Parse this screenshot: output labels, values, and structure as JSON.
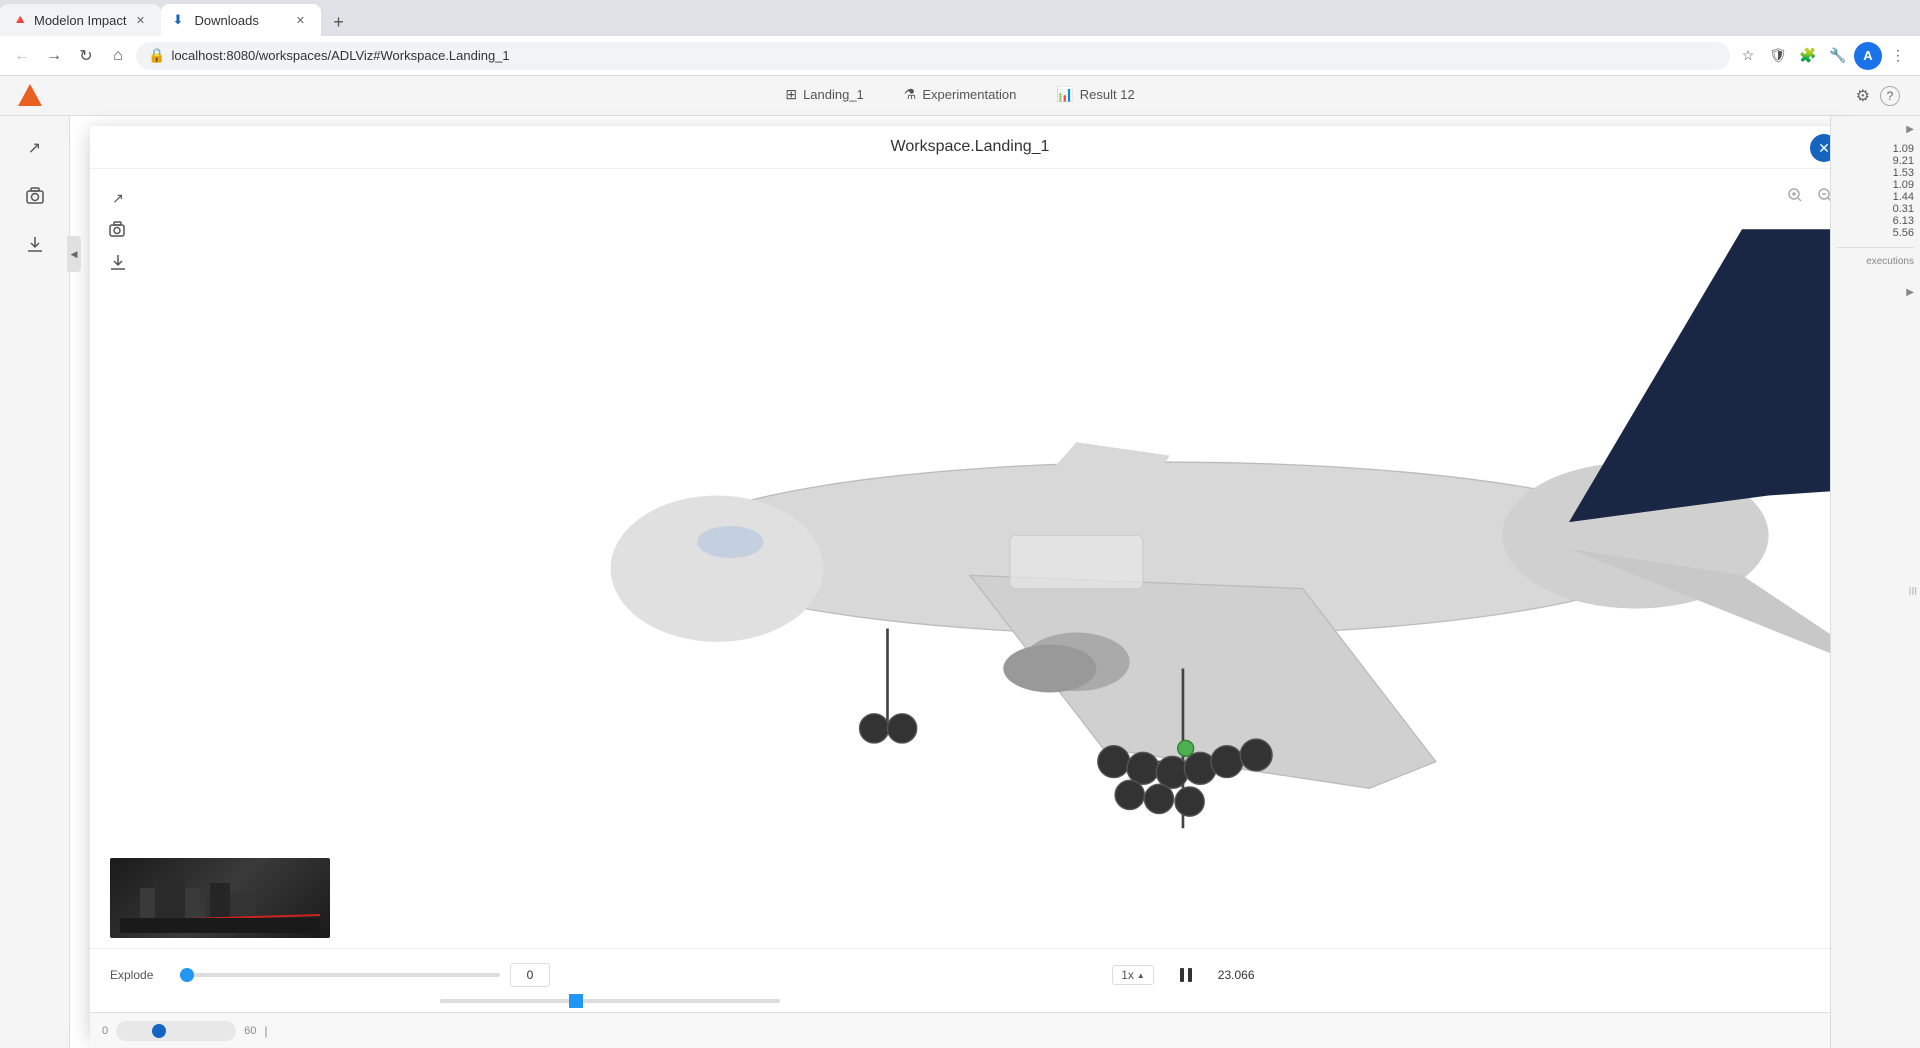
{
  "browser": {
    "tabs": [
      {
        "id": "tab1",
        "title": "Modelon Impact",
        "favicon": "🔺",
        "active": false
      },
      {
        "id": "tab2",
        "title": "Downloads",
        "favicon": "⬇",
        "active": true
      }
    ],
    "url": "localhost:8080/workspaces/ADLViz#Workspace.Landing_1",
    "new_tab_label": "+"
  },
  "app": {
    "logo": "▲",
    "toolbar_tabs": [
      {
        "id": "landing",
        "icon": "⊞",
        "label": "Landing_1"
      },
      {
        "id": "experimentation",
        "icon": "⚗",
        "label": "Experimentation"
      },
      {
        "id": "result",
        "icon": "📊",
        "label": "Result 12"
      }
    ],
    "settings_label": "⚙",
    "help_label": "?"
  },
  "modal": {
    "title": "Workspace.Landing_1",
    "close_label": "✕"
  },
  "viewport": {
    "controls": {
      "expand_label": "↗",
      "camera_label": "📷",
      "download_label": "⬇"
    },
    "zoom_in_label": "🔍",
    "zoom_out_label": "🔍"
  },
  "bottom_controls": {
    "explode_label": "Explode",
    "explode_value": "0",
    "explode_slider_pct": 0,
    "speed_label": "1x",
    "speed_arrow": "▲",
    "pause_label": "⏸",
    "time_value": "23.066",
    "timeline_slider_pct": 38,
    "timeline_start": "0",
    "timeline_end": "60"
  },
  "right_panel": {
    "values": [
      "1.09",
      "9.21",
      "1.53",
      "1.09",
      "1.44",
      "0.31",
      "6.13",
      "5.56"
    ],
    "executions_label": "executions"
  },
  "sidebar": {
    "collapse_arrow": "◀",
    "right_arrows": [
      "▶",
      "▶"
    ]
  }
}
